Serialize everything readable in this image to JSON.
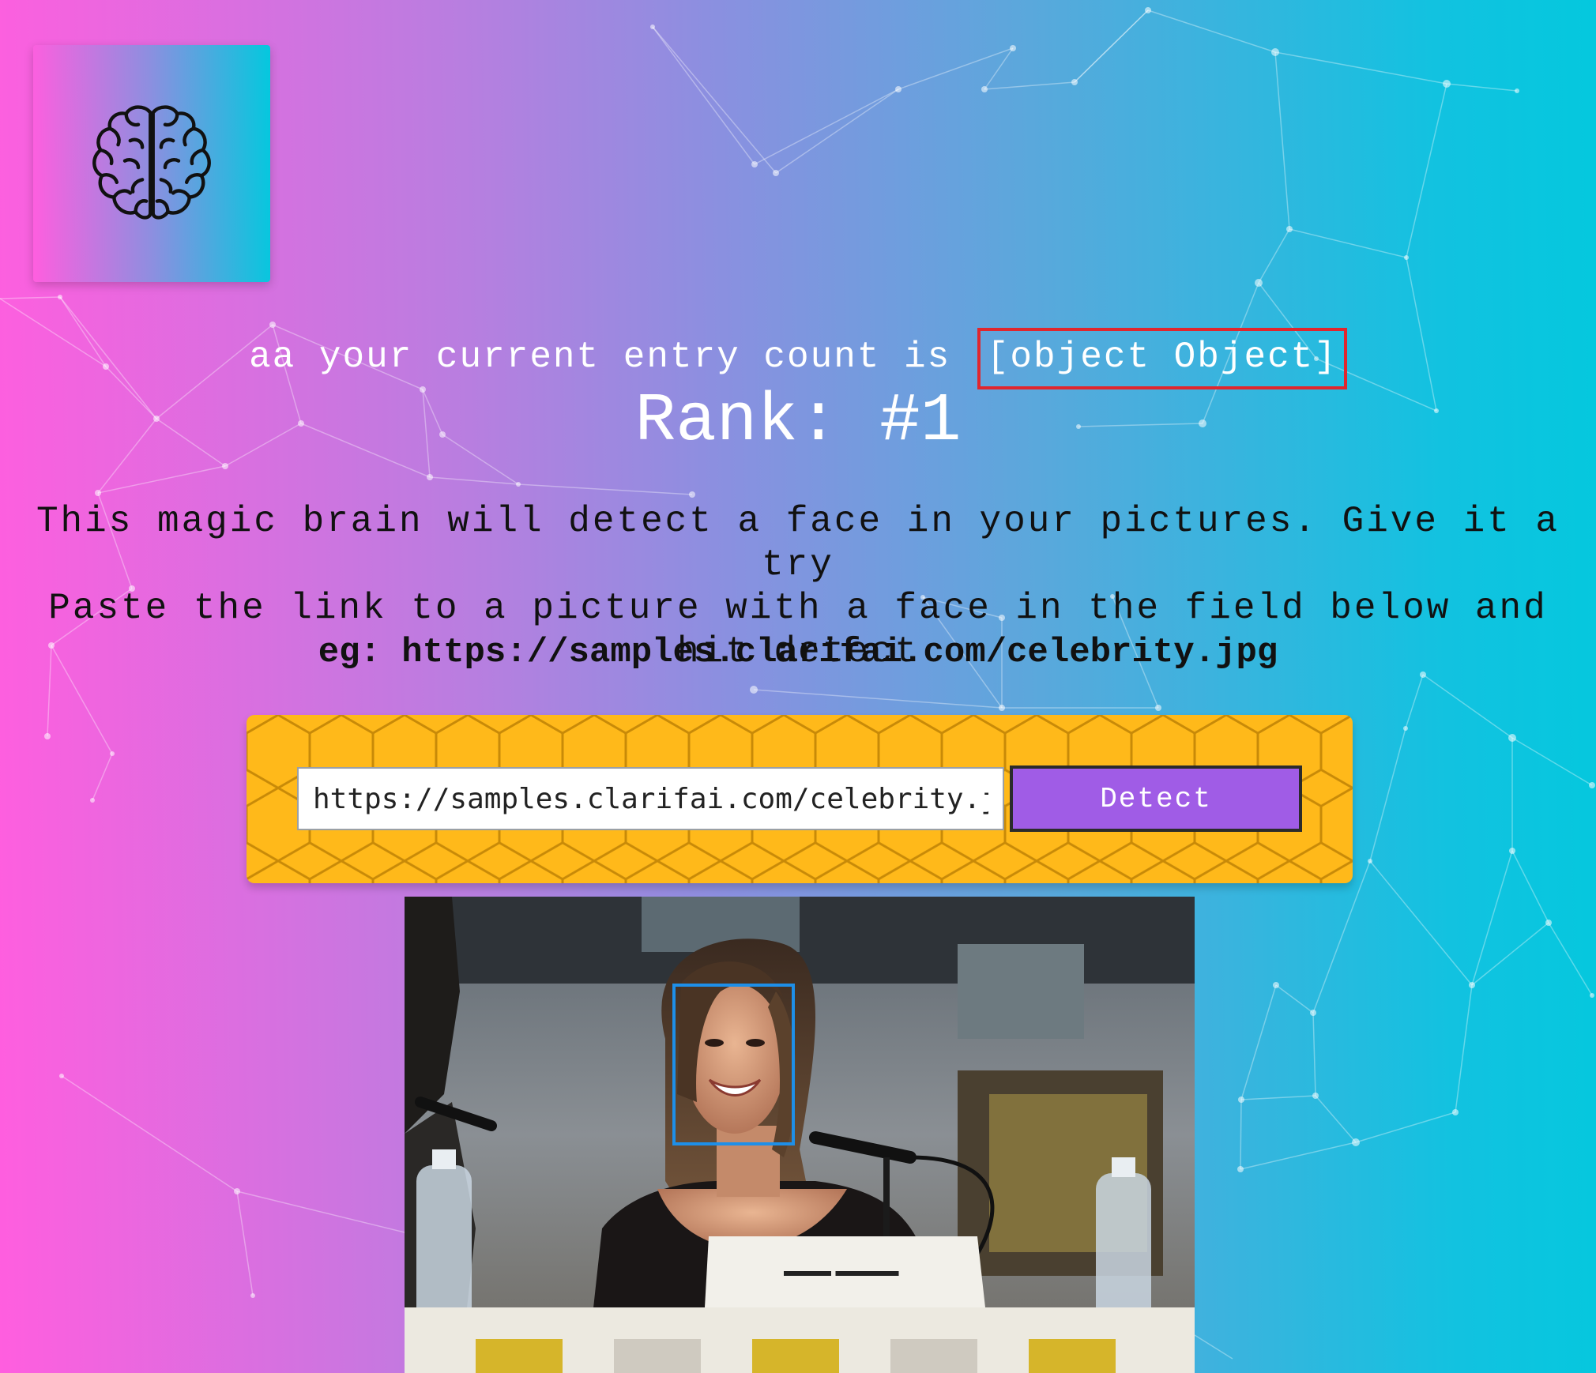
{
  "app": {
    "logo": "brain-icon"
  },
  "user": {
    "greeting_prefix": "aa your current entry count is ",
    "entry_count": "[object Object]",
    "rank_label": "Rank: #1"
  },
  "intro": {
    "line1": "This magic brain will detect a face in your pictures. Give it a try",
    "line2": "Paste the link to a picture with a face in the field below and hit detect",
    "example": "eg: https://samples.clarifai.com/celebrity.jpg"
  },
  "form": {
    "url_value": "https://samples.clarifai.com/celebrity.jpg",
    "detect_label": "Detect"
  },
  "colors": {
    "panel": "#ffb91a",
    "button": "#a05ce6",
    "face_box": "#1e8fe8",
    "highlight": "#e0262e"
  }
}
